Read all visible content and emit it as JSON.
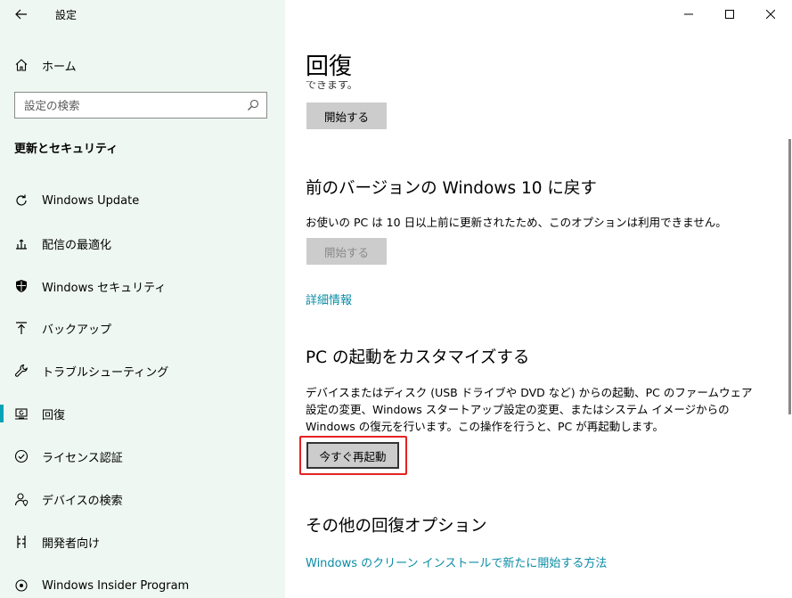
{
  "sidebar": {
    "app_title": "設定",
    "home_label": "ホーム",
    "search_placeholder": "設定の検索",
    "section_heading": "更新とセキュリティ",
    "items": [
      {
        "label": "Windows Update",
        "icon": "refresh-icon",
        "selected": false
      },
      {
        "label": "配信の最適化",
        "icon": "delivery-optimization-icon",
        "selected": false
      },
      {
        "label": "Windows セキュリティ",
        "icon": "shield-icon",
        "selected": false
      },
      {
        "label": "バックアップ",
        "icon": "backup-icon",
        "selected": false
      },
      {
        "label": "トラブルシューティング",
        "icon": "wrench-icon",
        "selected": false
      },
      {
        "label": "回復",
        "icon": "recovery-icon",
        "selected": true
      },
      {
        "label": "ライセンス認証",
        "icon": "check-circle-icon",
        "selected": false
      },
      {
        "label": "デバイスの検索",
        "icon": "person-location-icon",
        "selected": false
      },
      {
        "label": "開発者向け",
        "icon": "developer-icon",
        "selected": false
      },
      {
        "label": "Windows Insider Program",
        "icon": "insider-icon",
        "selected": false
      }
    ]
  },
  "content": {
    "page_title": "回復",
    "clipped_text": "できます。",
    "reset_section": {
      "button_label": "開始する"
    },
    "go_back_section": {
      "title": "前のバージョンの Windows 10 に戻す",
      "description": "お使いの PC は 10 日以上前に更新されたため、このオプションは利用できません。",
      "button_label": "開始する",
      "button_disabled": true
    },
    "details_link": "詳細情報",
    "advanced_startup": {
      "title": "PC の起動をカスタマイズする",
      "description_lines": [
        "デバイスまたはディスク (USB ドライブや DVD など) からの起動、PC のファームウェア",
        "設定の変更、Windows スタートアップ設定の変更、またはシステム イメージからの",
        "Windows の復元を行います。この操作を行うと、PC が再起動します。"
      ],
      "button_label": "今すぐ再起動"
    },
    "more_options": {
      "title": "その他の回復オプション",
      "link": "Windows のクリーン インストールで新たに開始する方法"
    }
  },
  "colors": {
    "sidebar_bg": "#eef7f1",
    "accent": "#0aa3b5",
    "link": "#0a8ca6",
    "highlight": "#e62222",
    "button_bg": "#cccccc"
  }
}
